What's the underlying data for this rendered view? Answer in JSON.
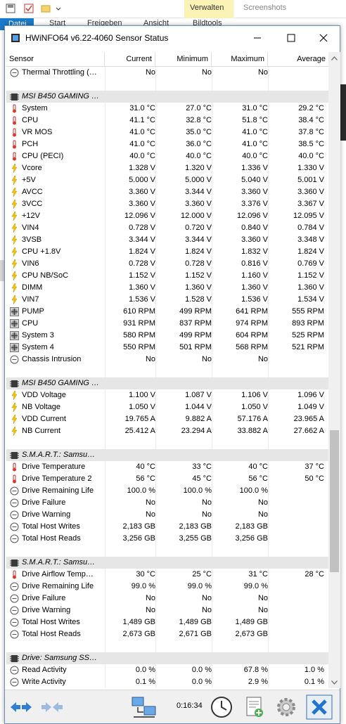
{
  "background": {
    "tabs": [
      "Datei",
      "Start",
      "Freigeben",
      "Ansicht",
      "Bildtools"
    ],
    "context_tab": "Verwalten",
    "context_tab2": "Screenshots"
  },
  "window": {
    "title": "HWiNFO64 v6.22-4060 Sensor Status",
    "min_label": "—",
    "max_label": "☐",
    "close_label": "✕"
  },
  "columns": [
    "Sensor",
    "Current",
    "Minimum",
    "Maximum",
    "Average"
  ],
  "rows": [
    {
      "type": "data",
      "icon": "circle",
      "name": "Thermal Throttling (…",
      "cur": "No",
      "min": "No",
      "max": "No",
      "avg": ""
    },
    {
      "type": "blank"
    },
    {
      "type": "header",
      "name": "MSI B450 GAMING …"
    },
    {
      "type": "data",
      "icon": "temp",
      "name": "System",
      "cur": "31.0 °C",
      "min": "27.0 °C",
      "max": "31.0 °C",
      "avg": "29.2 °C"
    },
    {
      "type": "data",
      "icon": "temp",
      "name": "CPU",
      "cur": "41.1 °C",
      "min": "32.8 °C",
      "max": "51.8 °C",
      "avg": "38.4 °C"
    },
    {
      "type": "data",
      "icon": "temp",
      "name": "VR MOS",
      "cur": "41.0 °C",
      "min": "35.0 °C",
      "max": "41.0 °C",
      "avg": "37.8 °C"
    },
    {
      "type": "data",
      "icon": "temp",
      "name": "PCH",
      "cur": "41.0 °C",
      "min": "36.0 °C",
      "max": "41.0 °C",
      "avg": "38.5 °C"
    },
    {
      "type": "data",
      "icon": "temp",
      "name": "CPU (PECI)",
      "cur": "40.0 °C",
      "min": "40.0 °C",
      "max": "40.0 °C",
      "avg": "40.0 °C"
    },
    {
      "type": "data",
      "icon": "volt",
      "name": "Vcore",
      "cur": "1.328 V",
      "min": "1.320 V",
      "max": "1.336 V",
      "avg": "1.330 V"
    },
    {
      "type": "data",
      "icon": "volt",
      "name": "+5V",
      "cur": "5.000 V",
      "min": "5.000 V",
      "max": "5.040 V",
      "avg": "5.001 V"
    },
    {
      "type": "data",
      "icon": "volt",
      "name": "AVCC",
      "cur": "3.360 V",
      "min": "3.344 V",
      "max": "3.360 V",
      "avg": "3.360 V"
    },
    {
      "type": "data",
      "icon": "volt",
      "name": "3VCC",
      "cur": "3.360 V",
      "min": "3.360 V",
      "max": "3.376 V",
      "avg": "3.367 V"
    },
    {
      "type": "data",
      "icon": "volt",
      "name": "+12V",
      "cur": "12.096 V",
      "min": "12.000 V",
      "max": "12.096 V",
      "avg": "12.095 V"
    },
    {
      "type": "data",
      "icon": "volt",
      "name": "VIN4",
      "cur": "0.728 V",
      "min": "0.720 V",
      "max": "0.840 V",
      "avg": "0.784 V"
    },
    {
      "type": "data",
      "icon": "volt",
      "name": "3VSB",
      "cur": "3.344 V",
      "min": "3.344 V",
      "max": "3.360 V",
      "avg": "3.348 V"
    },
    {
      "type": "data",
      "icon": "volt",
      "name": "CPU +1.8V",
      "cur": "1.824 V",
      "min": "1.824 V",
      "max": "1.832 V",
      "avg": "1.824 V"
    },
    {
      "type": "data",
      "icon": "volt",
      "name": "VIN6",
      "cur": "0.728 V",
      "min": "0.728 V",
      "max": "0.816 V",
      "avg": "0.769 V"
    },
    {
      "type": "data",
      "icon": "volt",
      "name": "CPU NB/SoC",
      "cur": "1.152 V",
      "min": "1.152 V",
      "max": "1.160 V",
      "avg": "1.152 V"
    },
    {
      "type": "data",
      "icon": "volt",
      "name": "DIMM",
      "cur": "1.360 V",
      "min": "1.360 V",
      "max": "1.360 V",
      "avg": "1.360 V"
    },
    {
      "type": "data",
      "icon": "volt",
      "name": "VIN7",
      "cur": "1.536 V",
      "min": "1.528 V",
      "max": "1.536 V",
      "avg": "1.534 V"
    },
    {
      "type": "data",
      "icon": "fan",
      "name": "PUMP",
      "cur": "610 RPM",
      "min": "499 RPM",
      "max": "641 RPM",
      "avg": "555 RPM"
    },
    {
      "type": "data",
      "icon": "fan",
      "name": "CPU",
      "cur": "931 RPM",
      "min": "837 RPM",
      "max": "974 RPM",
      "avg": "893 RPM"
    },
    {
      "type": "data",
      "icon": "fan",
      "name": "System 3",
      "cur": "580 RPM",
      "min": "499 RPM",
      "max": "604 RPM",
      "avg": "525 RPM"
    },
    {
      "type": "data",
      "icon": "fan",
      "name": "System 4",
      "cur": "550 RPM",
      "min": "501 RPM",
      "max": "568 RPM",
      "avg": "521 RPM"
    },
    {
      "type": "data",
      "icon": "circle",
      "name": "Chassis Intrusion",
      "cur": "No",
      "min": "No",
      "max": "No",
      "avg": ""
    },
    {
      "type": "blank"
    },
    {
      "type": "header",
      "name": "MSI B450 GAMING …"
    },
    {
      "type": "data",
      "icon": "volt",
      "name": "VDD Voltage",
      "cur": "1.100 V",
      "min": "1.087 V",
      "max": "1.106 V",
      "avg": "1.096 V"
    },
    {
      "type": "data",
      "icon": "volt",
      "name": "NB Voltage",
      "cur": "1.050 V",
      "min": "1.044 V",
      "max": "1.050 V",
      "avg": "1.049 V"
    },
    {
      "type": "data",
      "icon": "volt",
      "name": "VDD Current",
      "cur": "19.765 A",
      "min": "9.882 A",
      "max": "57.176 A",
      "avg": "23.965 A"
    },
    {
      "type": "data",
      "icon": "volt",
      "name": "NB Current",
      "cur": "25.412 A",
      "min": "23.294 A",
      "max": "33.882 A",
      "avg": "27.662 A"
    },
    {
      "type": "blank"
    },
    {
      "type": "header",
      "name": "S.M.A.R.T.: Samsu…"
    },
    {
      "type": "data",
      "icon": "temp",
      "name": "Drive Temperature",
      "cur": "40 °C",
      "min": "33 °C",
      "max": "40 °C",
      "avg": "37 °C"
    },
    {
      "type": "data",
      "icon": "temp",
      "name": "Drive Temperature 2",
      "cur": "56 °C",
      "min": "45 °C",
      "max": "56 °C",
      "avg": "50 °C"
    },
    {
      "type": "data",
      "icon": "circle",
      "name": "Drive Remaining Life",
      "cur": "100.0 %",
      "min": "100.0 %",
      "max": "100.0 %",
      "avg": ""
    },
    {
      "type": "data",
      "icon": "circle",
      "name": "Drive Failure",
      "cur": "No",
      "min": "No",
      "max": "No",
      "avg": ""
    },
    {
      "type": "data",
      "icon": "circle",
      "name": "Drive Warning",
      "cur": "No",
      "min": "No",
      "max": "No",
      "avg": ""
    },
    {
      "type": "data",
      "icon": "circle",
      "name": "Total Host Writes",
      "cur": "2,183 GB",
      "min": "2,183 GB",
      "max": "2,183 GB",
      "avg": ""
    },
    {
      "type": "data",
      "icon": "circle",
      "name": "Total Host Reads",
      "cur": "3,256 GB",
      "min": "3,255 GB",
      "max": "3,256 GB",
      "avg": ""
    },
    {
      "type": "blank"
    },
    {
      "type": "header",
      "name": "S.M.A.R.T.: Samsu…"
    },
    {
      "type": "data",
      "icon": "temp",
      "name": "Drive Airflow Temp…",
      "cur": "30 °C",
      "min": "25 °C",
      "max": "31 °C",
      "avg": "28 °C"
    },
    {
      "type": "data",
      "icon": "circle",
      "name": "Drive Remaining Life",
      "cur": "99.0 %",
      "min": "99.0 %",
      "max": "99.0 %",
      "avg": ""
    },
    {
      "type": "data",
      "icon": "circle",
      "name": "Drive Failure",
      "cur": "No",
      "min": "No",
      "max": "No",
      "avg": ""
    },
    {
      "type": "data",
      "icon": "circle",
      "name": "Drive Warning",
      "cur": "No",
      "min": "No",
      "max": "No",
      "avg": ""
    },
    {
      "type": "data",
      "icon": "circle",
      "name": "Total Host Writes",
      "cur": "1,489 GB",
      "min": "1,489 GB",
      "max": "1,489 GB",
      "avg": ""
    },
    {
      "type": "data",
      "icon": "circle",
      "name": "Total Host Reads",
      "cur": "2,673 GB",
      "min": "2,671 GB",
      "max": "2,673 GB",
      "avg": ""
    },
    {
      "type": "blank"
    },
    {
      "type": "header",
      "name": "Drive: Samsung SS…"
    },
    {
      "type": "data",
      "icon": "circle",
      "name": "Read Activity",
      "cur": "0.0 %",
      "min": "0.0 %",
      "max": "67.8 %",
      "avg": "1.0 %"
    },
    {
      "type": "data",
      "icon": "circle",
      "name": "Write Activity",
      "cur": "0.1 %",
      "min": "0.0 %",
      "max": "2.9 %",
      "avg": "0.1 %"
    }
  ],
  "bottom": {
    "elapsed": "0:16:34"
  },
  "icons": {
    "temp": "thermometer-icon",
    "volt": "lightning-icon",
    "fan": "fan-icon",
    "circle": "status-circle-icon",
    "header": "chip-icon"
  },
  "colors": {
    "accent": "#1979ca",
    "header_row": "#e6e6e6",
    "volt_icon": "#f5c400",
    "temp_icon": "#d83b2b",
    "close_btn": "#0078d7"
  }
}
